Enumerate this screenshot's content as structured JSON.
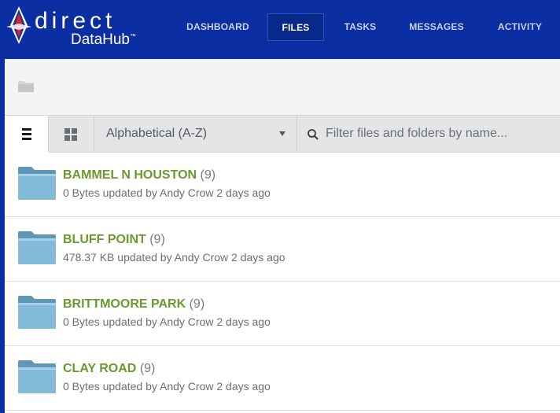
{
  "brand": {
    "name": "direct",
    "subname": "DataHub",
    "tm": "™"
  },
  "nav": {
    "items": [
      {
        "label": "DASHBOARD",
        "active": false
      },
      {
        "label": "FILES",
        "active": true
      },
      {
        "label": "TASKS",
        "active": false
      },
      {
        "label": "MESSAGES",
        "active": false
      },
      {
        "label": "ACTIVITY",
        "active": false
      }
    ]
  },
  "breadcrumb": {
    "icon": "folder-icon"
  },
  "toolbar": {
    "list_view_icon": "list-view-icon",
    "grid_view_icon": "grid-view-icon",
    "sort_selected": "Alphabetical (A-Z)",
    "search_placeholder": "Filter files and folders by name..."
  },
  "files": [
    {
      "name": "BAMMEL N HOUSTON",
      "count": "(9)",
      "size": "0 Bytes",
      "updated_text": "updated by Andy Crow 2 days ago"
    },
    {
      "name": "BLUFF POINT",
      "count": "(9)",
      "size": "478.37 KB",
      "updated_text": "updated by Andy Crow 2 days ago"
    },
    {
      "name": "BRITTMOORE PARK",
      "count": "(9)",
      "size": "0 Bytes",
      "updated_text": "updated by Andy Crow 2 days ago"
    },
    {
      "name": "CLAY ROAD",
      "count": "(9)",
      "size": "0 Bytes",
      "updated_text": "updated by Andy Crow 2 days ago"
    }
  ],
  "colors": {
    "header_bg": "#0b2fa3",
    "folder_name": "#6a9a2d",
    "logo_red": "#d4252c"
  }
}
